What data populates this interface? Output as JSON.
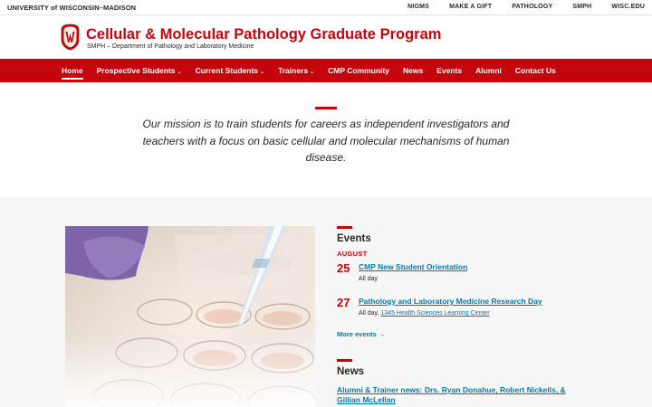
{
  "utility": {
    "university": "UNIVERSITY of WISCONSIN–MADISON",
    "links": [
      "NIGMS",
      "MAKE A GIFT",
      "PATHOLOGY",
      "SMPH",
      "WISC.EDU"
    ]
  },
  "header": {
    "title": "Cellular & Molecular Pathology Graduate Program",
    "subtitle": "SMPH – Department of Pathology and Laboratory Medicine"
  },
  "nav": {
    "items": [
      {
        "label": "Home",
        "caret": ""
      },
      {
        "label": "Prospective Students",
        "caret": "⌄"
      },
      {
        "label": "Current Students",
        "caret": "⌄"
      },
      {
        "label": "Trainers",
        "caret": "⌄"
      },
      {
        "label": "CMP Community",
        "caret": ""
      },
      {
        "label": "News",
        "caret": ""
      },
      {
        "label": "Events",
        "caret": ""
      },
      {
        "label": "Alumni",
        "caret": ""
      },
      {
        "label": "Contact Us",
        "caret": ""
      }
    ]
  },
  "mission": {
    "text": "Our mission is to train students for careers as independent investigators and teachers with a focus on basic cellular and molecular mechanisms of human disease."
  },
  "events": {
    "heading": "Events",
    "month": "AUGUST",
    "items": [
      {
        "day": "25",
        "title": "CMP New Student Orientation",
        "meta": "All day",
        "location": ""
      },
      {
        "day": "27",
        "title": "Pathology and Laboratory Medicine Research Day",
        "meta": "All day, ",
        "location": "1345 Health Sciences Learning Center"
      }
    ],
    "more": "More events →"
  },
  "news": {
    "heading": "News",
    "items": [
      {
        "title": "Alumni & Trainer news: Drs. Ryan Donahue, Robert Nickells, & Gillian McLellan"
      }
    ]
  },
  "colors": {
    "brand_red": "#c5050c",
    "link_blue": "#0479a8",
    "text": "#282728",
    "section_bg": "#f7f7f7"
  }
}
